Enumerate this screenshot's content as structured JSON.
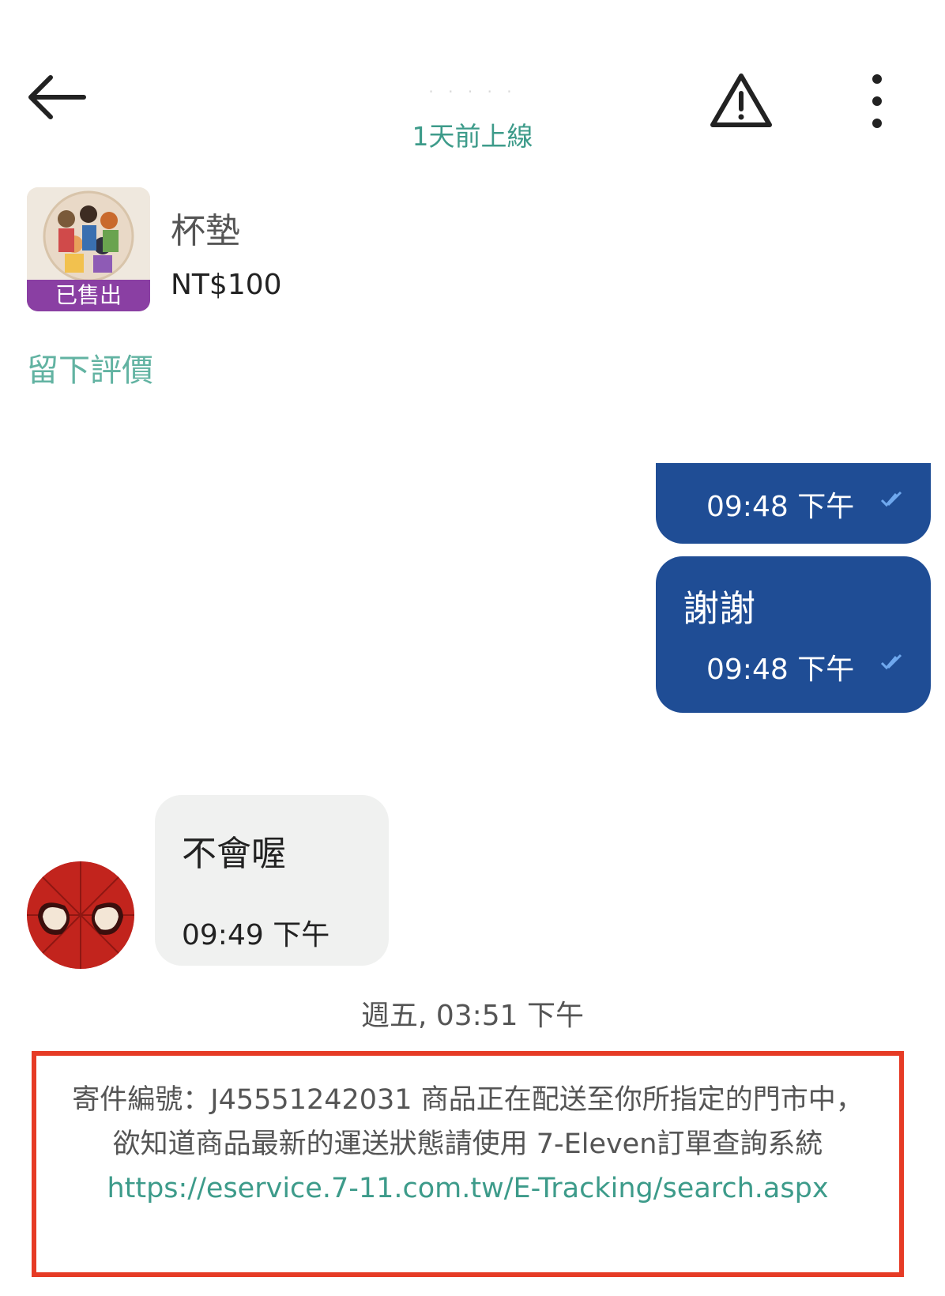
{
  "header": {
    "contact_name": "· · · · ·",
    "status": "1天前上線",
    "icons": {
      "back": "arrow-left-icon",
      "report": "warning-triangle-icon",
      "menu": "more-vertical-icon"
    }
  },
  "product": {
    "title": "杯墊",
    "price": "NT$100",
    "badge": "已售出"
  },
  "review_link": "留下評價",
  "messages": [
    {
      "direction": "outgoing",
      "text": "",
      "time": "09:48 下午",
      "status_icon": "double-check-icon"
    },
    {
      "direction": "outgoing",
      "text": "謝謝",
      "time": "09:48 下午",
      "status_icon": "double-check-icon"
    },
    {
      "direction": "incoming",
      "text": "不會喔",
      "time": "09:49 下午"
    }
  ],
  "date_separator": "週五, 03:51 下午",
  "system_notice": {
    "text": "寄件編號：J45551242031 商品正在配送至你所指定的門市中，欲知道商品最新的運送狀態請使用 7-Eleven訂單查詢系統",
    "link": "https://eservice.7-11.com.tw/E-Tracking/search.aspx"
  },
  "colors": {
    "accent": "#3d9b8a",
    "outgoing_bubble": "#1f4d95",
    "incoming_bubble": "#f0f1f0",
    "sold_badge": "#8a3fa3",
    "highlight_border": "#e63b25"
  }
}
